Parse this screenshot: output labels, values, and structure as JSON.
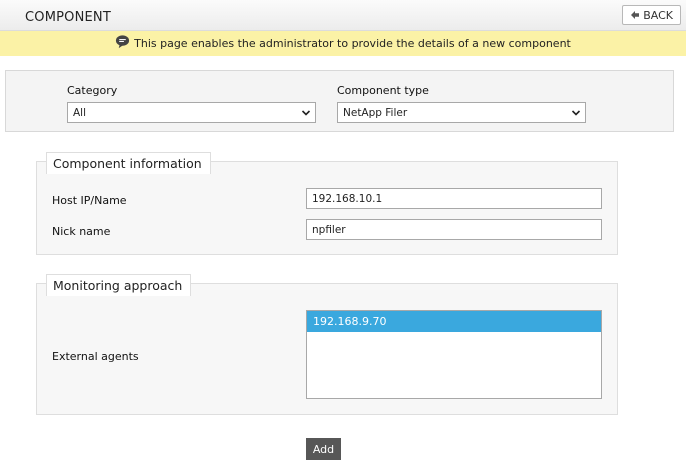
{
  "header": {
    "title": "COMPONENT",
    "back_label": "BACK"
  },
  "banner": {
    "text": "This page enables the administrator to provide the details of a new component"
  },
  "filters": {
    "category_label": "Category",
    "category_value": "All",
    "component_type_label": "Component type",
    "component_type_value": "NetApp Filer"
  },
  "component_info": {
    "legend": "Component information",
    "host_label": "Host IP/Name",
    "host_value": "192.168.10.1",
    "nick_label": "Nick name",
    "nick_value": "npfiler"
  },
  "monitoring": {
    "legend": "Monitoring approach",
    "agents_label": "External agents",
    "agents": [
      "192.168.9.70"
    ]
  },
  "actions": {
    "add_label": "Add"
  },
  "icons": {
    "back": "back-arrow-icon",
    "info": "speech-bubble-icon",
    "dropdown": "chevron-down-icon"
  },
  "colors": {
    "banner_bg": "#fbf2a6",
    "selected_option": "#3aa8de",
    "add_button": "#575757"
  }
}
